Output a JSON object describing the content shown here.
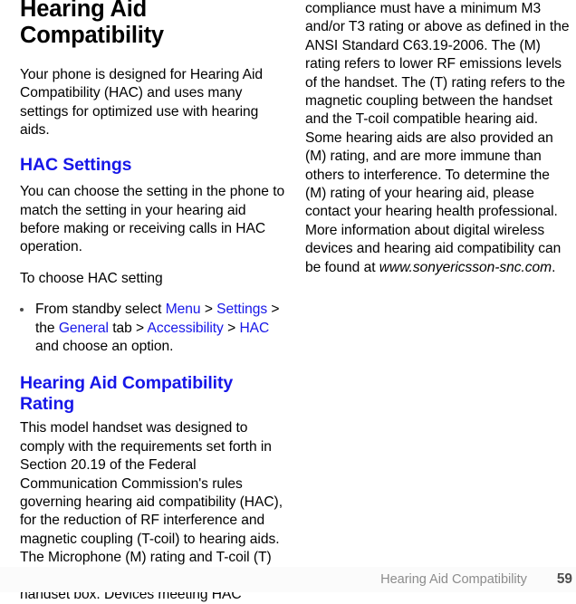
{
  "document": {
    "title": "Hearing Aid Compatibility",
    "page_number": "59"
  },
  "left_column": {
    "title": "Hearing Aid Compatibility",
    "intro_paragraph": "Your phone is designed for Hearing Aid Compatibility (HAC) and uses many settings for optimized use with hearing aids.",
    "hac_settings": {
      "heading": "HAC Settings",
      "paragraph": "You can choose the setting in the phone to match the setting in your hearing aid before making or receiving calls in HAC operation.",
      "subheading": "To choose HAC setting",
      "bullet": {
        "part1": "From standby select ",
        "link1": "Menu",
        "sep1": " > ",
        "link2": "Settings",
        "sep2": " > the ",
        "link3": "General",
        "sep3": " tab > ",
        "link4": "Accessibility",
        "sep4": " > ",
        "link5": "HAC",
        "part_end": " and choose an option."
      }
    },
    "rating": {
      "heading": "Hearing Aid Compatibility Rating",
      "paragraph": "This model handset was designed to comply with the requirements set forth in Section 20.19 of the Federal Communication Commission's rules governing hearing aid compatibility (HAC), for the reduction of RF interference and magnetic coupling (T-coil) to hearing aids. The Microphone (M) rating and T-coil (T) rating is defined and labeled on the handset box. Devices meeting HAC"
    }
  },
  "right_column": {
    "paragraph_start": "compliance must have a minimum M3 and/or T3 rating or above as defined in the ANSI Standard C63.19-2006. The (M) rating refers to lower RF emissions levels of the handset. The (T) rating refers to the magnetic coupling between the handset and the T-coil compatible hearing aid. Some hearing aids are also provided an (M) rating, and are more immune than others to interference. To determine the (M) rating of your hearing aid, please contact your hearing health professional. More information about digital wireless devices and hearing aid compatibility can be found at ",
    "website": "www.sonyericsson-snc.com",
    "paragraph_end": "."
  },
  "colors": {
    "link_blue": "#1616e8",
    "body_black": "#000000",
    "footer_gray": "#8c8c8c",
    "footer_pageno": "#4d4d4d",
    "footer_band": "#fbfbfb"
  }
}
